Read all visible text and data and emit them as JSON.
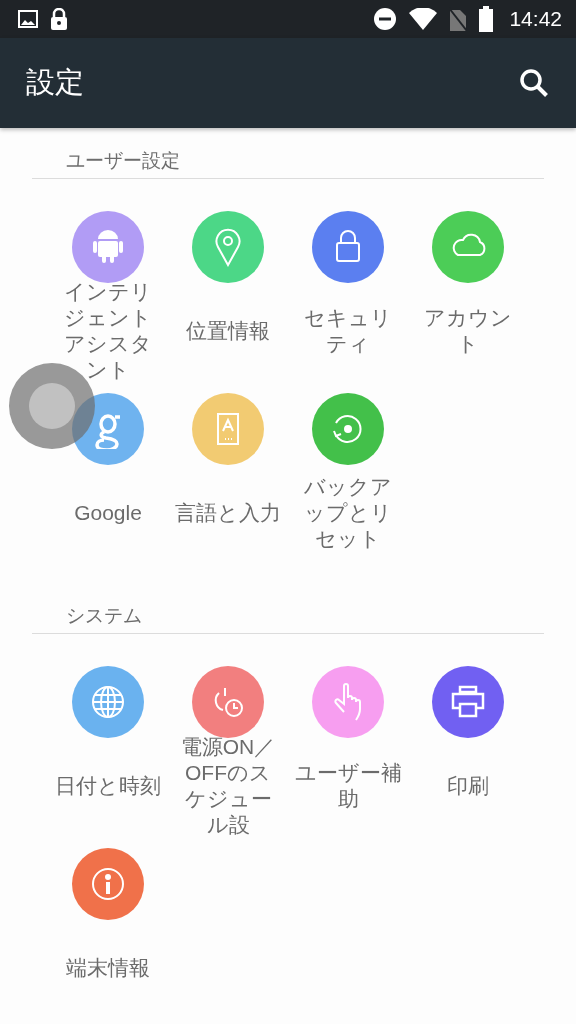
{
  "status_bar": {
    "time": "14:42"
  },
  "app_bar": {
    "title": "設定"
  },
  "sections": [
    {
      "title": "ユーザー設定",
      "items": [
        {
          "label": "インテリジェントアシスタント",
          "color": "#b19cf5"
        },
        {
          "label": "位置情報",
          "color": "#4cd787"
        },
        {
          "label": "セキュリティ",
          "color": "#5b7ff0"
        },
        {
          "label": "アカウント",
          "color": "#4ccd57"
        },
        {
          "label": "Google",
          "color": "#6fb3ef"
        },
        {
          "label": "言語と入力",
          "color": "#f2cb72"
        },
        {
          "label": "バックアップとリセット",
          "color": "#43c04a"
        }
      ]
    },
    {
      "title": "システム",
      "items": [
        {
          "label": "日付と時刻",
          "color": "#6ab2ef"
        },
        {
          "label": "電源ON／OFFのスケジュール設",
          "color": "#f27f7f"
        },
        {
          "label": "ユーザー補助",
          "color": "#f79ef0"
        },
        {
          "label": "印刷",
          "color": "#7160f2"
        },
        {
          "label": "端末情報",
          "color": "#f0714a"
        }
      ]
    }
  ]
}
